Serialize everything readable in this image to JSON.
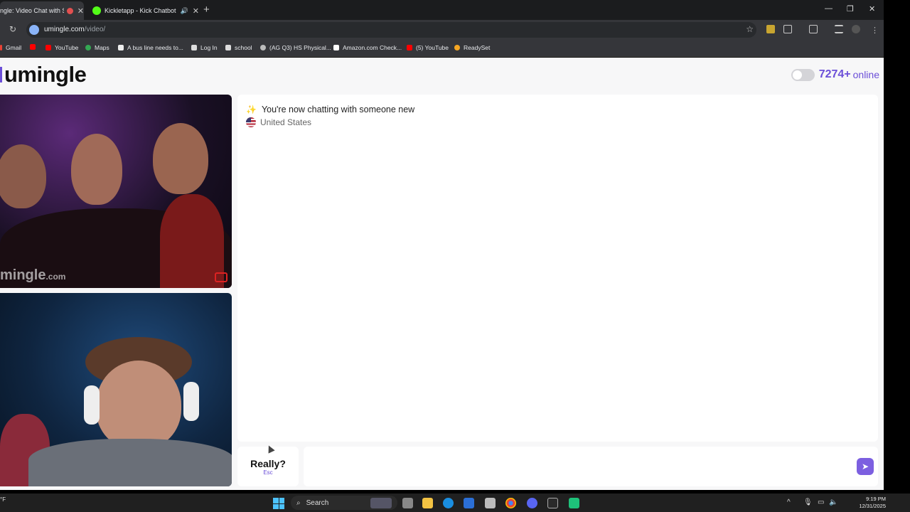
{
  "browser": {
    "tabs": [
      {
        "title": "ngle: Video Chat with S",
        "active": true
      },
      {
        "title": "Kickletapp - Kick Chatbot a",
        "active": false
      }
    ],
    "url_host": "umingle.com",
    "url_path": "/video/",
    "bookmarks": [
      "Gmail",
      "YouTube",
      "Maps",
      "A bus line needs to...",
      "Log In",
      "school",
      "(AG Q3) HS Physical...",
      "Amazon.com Check...",
      "(5) YouTube",
      "ReadySet"
    ]
  },
  "page": {
    "logo": "umingle",
    "online_count": "7274+",
    "online_label": "online",
    "watermark": "mingle",
    "watermark_domain": ".com",
    "chat": {
      "system_message": "You're now chatting with someone new",
      "country": "United States"
    },
    "stop_button": {
      "label": "Really?",
      "hint": "Esc"
    },
    "message_input": {
      "value": "",
      "placeholder": ""
    }
  },
  "taskbar": {
    "weather": "°F",
    "search_label": "Search",
    "time": "9:19 PM",
    "date": "12/31/2025"
  },
  "colors": {
    "brand": "#6b4fd8",
    "send": "#7c5fe0"
  }
}
